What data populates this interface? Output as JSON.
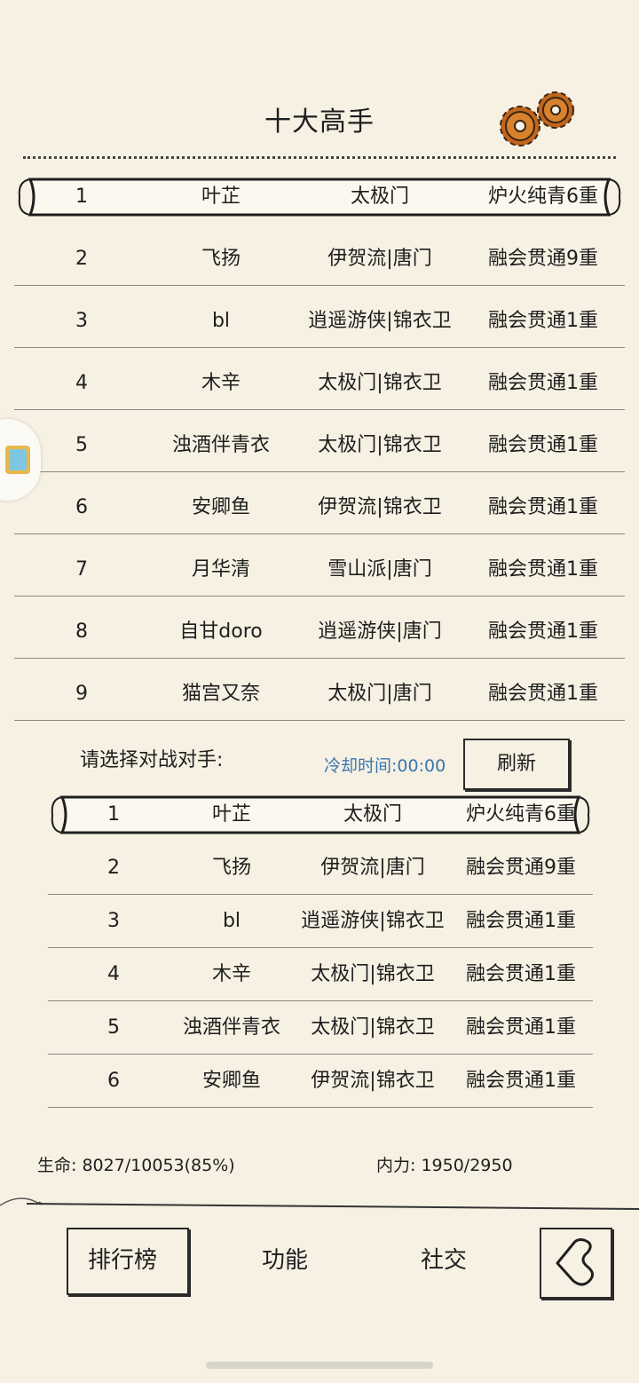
{
  "header": {
    "title": "十大高手"
  },
  "top10": [
    {
      "rank": "1",
      "name": "叶芷",
      "sect": "太极门",
      "level": "炉火纯青6重"
    },
    {
      "rank": "2",
      "name": "飞扬",
      "sect": "伊贺流|唐门",
      "level": "融会贯通9重"
    },
    {
      "rank": "3",
      "name": "bl",
      "sect": "逍遥游侠|锦衣卫",
      "level": "融会贯通1重"
    },
    {
      "rank": "4",
      "name": "木辛",
      "sect": "太极门|锦衣卫",
      "level": "融会贯通1重"
    },
    {
      "rank": "5",
      "name": "浊酒伴青衣",
      "sect": "太极门|锦衣卫",
      "level": "融会贯通1重"
    },
    {
      "rank": "6",
      "name": "安卿鱼",
      "sect": "伊贺流|锦衣卫",
      "level": "融会贯通1重"
    },
    {
      "rank": "7",
      "name": "月华清",
      "sect": "雪山派|唐门",
      "level": "融会贯通1重"
    },
    {
      "rank": "8",
      "name": "自甘doro",
      "sect": "逍遥游侠|唐门",
      "level": "融会贯通1重"
    },
    {
      "rank": "9",
      "name": "猫宫又奈",
      "sect": "太极门|唐门",
      "level": "融会贯通1重"
    }
  ],
  "opponent_select": {
    "label": "请选择对战对手:",
    "cooldown": "冷却时间:00:00",
    "refresh_label": "刷新"
  },
  "opponents": [
    {
      "rank": "1",
      "name": "叶芷",
      "sect": "太极门",
      "level": "炉火纯青6重"
    },
    {
      "rank": "2",
      "name": "飞扬",
      "sect": "伊贺流|唐门",
      "level": "融会贯通9重"
    },
    {
      "rank": "3",
      "name": "bl",
      "sect": "逍遥游侠|锦衣卫",
      "level": "融会贯通1重"
    },
    {
      "rank": "4",
      "name": "木辛",
      "sect": "太极门|锦衣卫",
      "level": "融会贯通1重"
    },
    {
      "rank": "5",
      "name": "浊酒伴青衣",
      "sect": "太极门|锦衣卫",
      "level": "融会贯通1重"
    },
    {
      "rank": "6",
      "name": "安卿鱼",
      "sect": "伊贺流|锦衣卫",
      "level": "融会贯通1重"
    }
  ],
  "status": {
    "hp": "生命:  8027/10053(85%)",
    "mp": "内力:  1950/2950"
  },
  "nav": {
    "ranking": "排行榜",
    "functions": "功能",
    "social": "社交"
  },
  "icons": {
    "gears": "gears-icon",
    "back": "back-arrow-icon",
    "side_tab": "floating-app-icon"
  },
  "colors": {
    "background": "#f6f1e3",
    "cooldown_text": "#3a76b0",
    "gear": "#c0661e"
  }
}
